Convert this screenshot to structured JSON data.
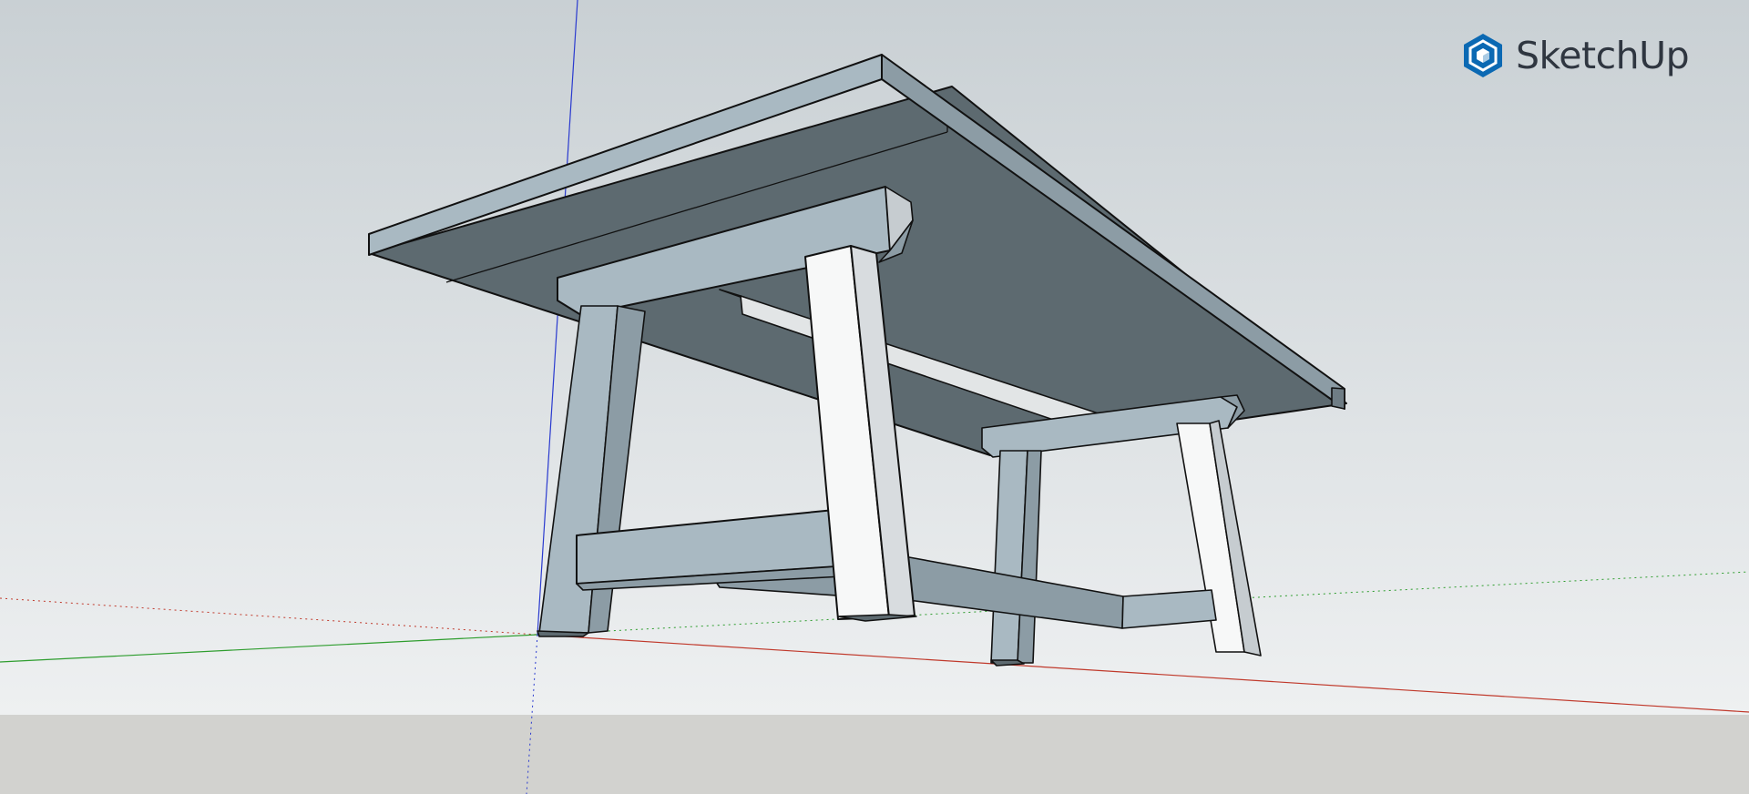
{
  "app": {
    "brand_name": "SketchUp",
    "brand_color": "#0b69b3",
    "brand_text_color": "#2f3640"
  },
  "scene": {
    "model": "table",
    "colors": {
      "sky_top": "#c9d0d4",
      "sky_bottom": "#eef0f1",
      "ground": "#d2d2cf",
      "face_front": "#a9b9c2",
      "face_side": "#8c9ca5",
      "face_underside": "#5d6a70",
      "face_lit": "#f7f8f8",
      "edge": "#111111",
      "axis_red": "#c0392b",
      "axis_green": "#2e9d2e",
      "axis_blue": "#2a3acf"
    }
  }
}
